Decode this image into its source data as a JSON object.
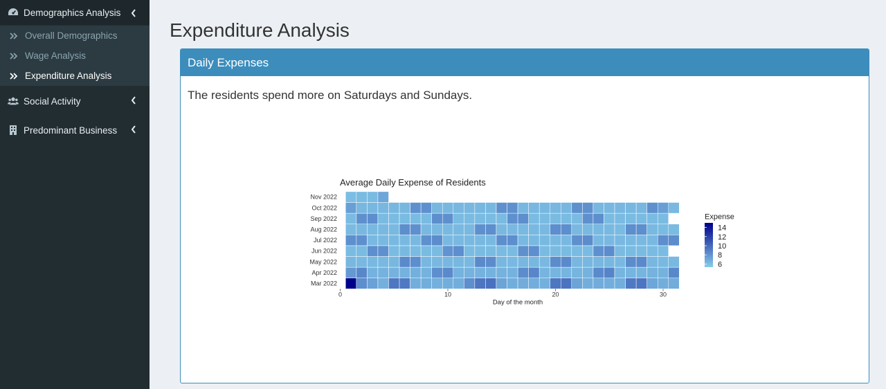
{
  "sidebar": {
    "items": [
      {
        "label": "Demographics Analysis",
        "icon": "dashboard-icon",
        "expanded": true,
        "children": [
          {
            "label": "Overall Demographics",
            "active": false
          },
          {
            "label": "Wage Analysis",
            "active": false
          },
          {
            "label": "Expenditure Analysis",
            "active": true
          }
        ]
      },
      {
        "label": "Social Activity",
        "icon": "users-icon"
      },
      {
        "label": "Predominant Business",
        "icon": "building-icon"
      }
    ]
  },
  "page": {
    "title": "Expenditure Analysis"
  },
  "box": {
    "header": "Daily Expenses",
    "text": "The residents spend more on Saturdays and Sundays."
  },
  "colors": {
    "sidebar": "#222d32",
    "accent": "#3c8dbc",
    "low": "#87ceeb",
    "high": "#00008b"
  },
  "chart_data": {
    "type": "heatmap",
    "title": "Average Daily Expense of Residents",
    "xlabel": "Day of the month",
    "ylabel": "",
    "xticks": [
      0,
      10,
      20,
      30
    ],
    "rows": [
      "Mar 2022",
      "Apr 2022",
      "May 2022",
      "Jun 2022",
      "Jul 2022",
      "Aug 2022",
      "Sep 2022",
      "Oct 2022",
      "Nov 2022"
    ],
    "legend": {
      "title": "Expense",
      "ticks": [
        14,
        12,
        10,
        8,
        6
      ],
      "min": 5.3,
      "max": 15
    },
    "values": [
      [
        15,
        8.3,
        7.4,
        6.7,
        9.4,
        9.3,
        6.8,
        6.8,
        6.7,
        6.8,
        6.8,
        8.3,
        9.5,
        9.7,
        7.3,
        6.8,
        6.9,
        6.8,
        6.7,
        9.4,
        9.6,
        7.3,
        6.8,
        6.9,
        6.8,
        6.8,
        9.3,
        9.5,
        7.2,
        6.8,
        6.9
      ],
      [
        7.8,
        8.6,
        6.6,
        6.6,
        6.6,
        6.6,
        6.7,
        6.6,
        8.3,
        8.5,
        6.6,
        6.6,
        6.6,
        6.6,
        6.6,
        6.6,
        8.4,
        8.7,
        6.5,
        6.5,
        6.5,
        6.5,
        6.6,
        8.5,
        8.8,
        6.5,
        6.5,
        6.5,
        6.6,
        6.6,
        8.6
      ],
      [
        6.4,
        6.3,
        6.3,
        6.3,
        6.4,
        8.5,
        8.3,
        6.4,
        6.3,
        6.4,
        6.4,
        6.3,
        8.5,
        8.4,
        6.4,
        6.3,
        6.4,
        6.4,
        6.3,
        8.4,
        8.5,
        6.4,
        6.4,
        6.4,
        6.4,
        6.3,
        8.4,
        8.5,
        6.4,
        6.3,
        6.3
      ],
      [
        6.2,
        6.2,
        8.3,
        8.2,
        6.2,
        6.3,
        6.2,
        6.2,
        6.2,
        8.1,
        8.3,
        6.2,
        6.2,
        6.2,
        6.2,
        6.2,
        8.2,
        8.3,
        6.2,
        6.2,
        6.2,
        6.2,
        6.2,
        8.2,
        8.4,
        6.2,
        6.2,
        6.2,
        6.2,
        6.2
      ],
      [
        8.2,
        8.2,
        6.3,
        6.3,
        6.3,
        6.3,
        6.3,
        8.2,
        8.4,
        6.3,
        6.3,
        6.3,
        6.3,
        6.3,
        8.3,
        8.3,
        6.3,
        6.3,
        6.3,
        6.3,
        6.3,
        8.2,
        8.4,
        6.3,
        6.3,
        6.3,
        6.3,
        6.3,
        6.3,
        8.3,
        8.4
      ],
      [
        6.2,
        6.3,
        6.3,
        6.3,
        6.3,
        8.3,
        8.2,
        6.3,
        6.3,
        6.3,
        6.3,
        6.3,
        8.2,
        8.3,
        6.3,
        6.3,
        6.3,
        6.3,
        6.3,
        8.3,
        8.3,
        6.3,
        6.3,
        6.3,
        6.3,
        6.2,
        8.3,
        8.3,
        6.3,
        6.2,
        6.2
      ],
      [
        6.2,
        8.2,
        8.3,
        6.2,
        6.2,
        6.2,
        6.2,
        6.2,
        8.3,
        8.2,
        6.2,
        6.2,
        6.2,
        6.2,
        6.2,
        8.2,
        8.3,
        6.2,
        6.2,
        6.2,
        6.2,
        6.2,
        8.2,
        8.3,
        6.2,
        6.2,
        6.2,
        6.2,
        6.2,
        6.2
      ],
      [
        7.5,
        6.4,
        6.4,
        6.4,
        6.4,
        6.4,
        8.2,
        8.2,
        6.4,
        6.4,
        6.4,
        6.4,
        6.4,
        6.4,
        8.2,
        8.2,
        6.4,
        6.4,
        6.4,
        6.4,
        6.4,
        8.2,
        8.2,
        6.4,
        6.4,
        6.4,
        6.4,
        6.4,
        8.2,
        7.5,
        6.3
      ],
      [
        6.1,
        6.2,
        6.2,
        7.2
      ]
    ]
  }
}
